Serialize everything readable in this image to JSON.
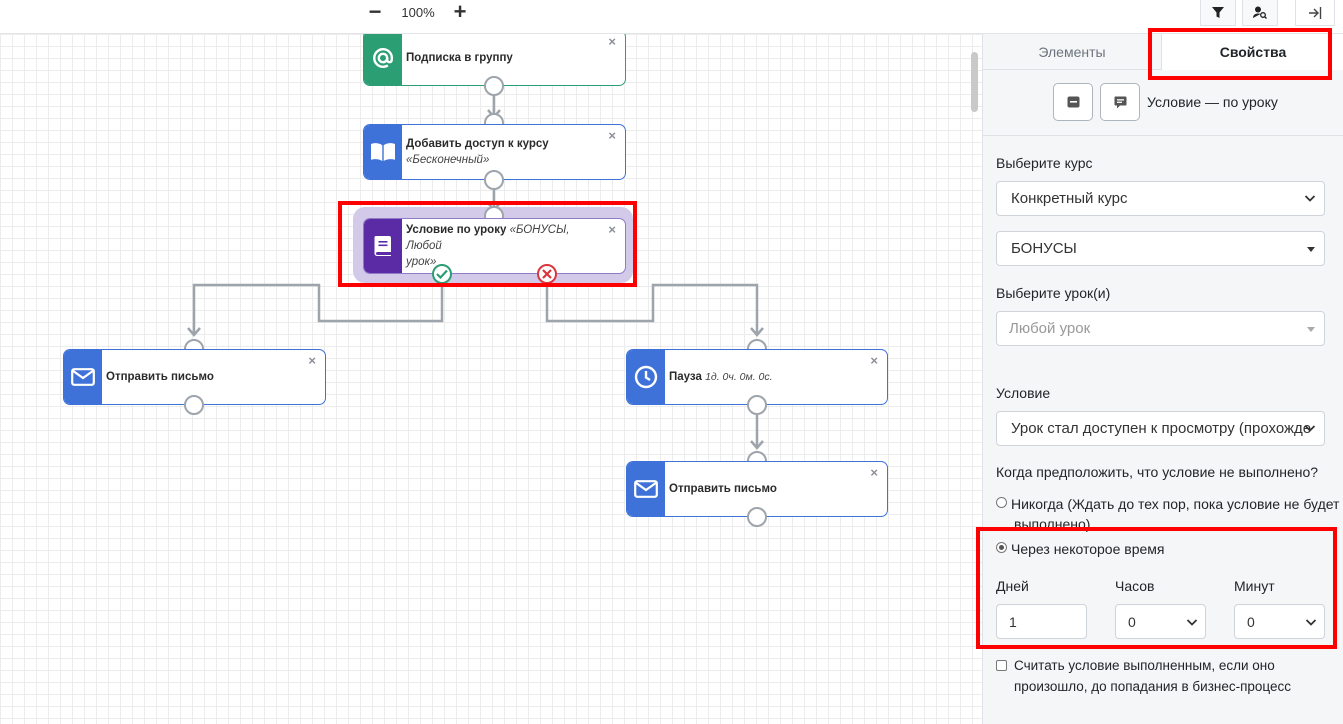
{
  "toolbar": {
    "zoom_out": "−",
    "zoom_level": "100%",
    "zoom_in": "+",
    "icons": [
      "filter-icon",
      "user-search-icon",
      "collapse-panel-icon"
    ]
  },
  "nodes": {
    "subscribe": {
      "title": "Подписка в группу",
      "icon": "at-icon",
      "color": "#2c9e73"
    },
    "add_access": {
      "title": "Добавить доступ к курсу",
      "subtitle": "«Бесконечный»",
      "icon": "book-open-icon",
      "color": "#3f72d9"
    },
    "condition": {
      "title": "Условие по уроку",
      "subtitle_inline": "«БОНУСЫ, Любой",
      "subtitle": "урок»",
      "icon": "lesson-book-icon",
      "color": "#5b2ba6"
    },
    "send_email_left": {
      "title": "Отправить письмо",
      "icon": "envelope-icon",
      "color": "#3f72d9"
    },
    "pause": {
      "title": "Пауза",
      "subtitle_inline": "1д. 0ч. 0м. 0с.",
      "icon": "clock-icon",
      "color": "#3f72d9"
    },
    "send_email_right": {
      "title": "Отправить письмо",
      "icon": "envelope-icon",
      "color": "#3f72d9"
    },
    "close_glyph": "×",
    "yes_color": "#2c9e73",
    "no_color": "#d9363e"
  },
  "panel": {
    "tabs": [
      "Элементы",
      "Свойства"
    ],
    "active_tab": "Свойства",
    "header": "Условие — по уроку",
    "course_label": "Выберите курс",
    "course_mode": "Конкретный курс",
    "course_value": "БОНУСЫ",
    "lesson_label": "Выберите урок(и)",
    "lesson_placeholder": "Любой урок",
    "condition_label": "Условие",
    "condition_value": "Урок стал доступен к просмотру (прохожде",
    "fail_question": "Когда предположить, что условие не выполнено?",
    "option_never_1": "Никогда (Ждать до тех пор, пока условие не будет",
    "option_never_2": "выполнено)",
    "option_after": "Через некоторое время",
    "days_label": "Дней",
    "days_value": "1",
    "hours_label": "Часов",
    "hours_value": "0",
    "minutes_label": "Минут",
    "minutes_value": "0",
    "checkbox_1": "Считать условие выполненным, если оно",
    "checkbox_2": "произошло, до попадания в бизнес-процесс"
  },
  "accent_red": "#ff0000"
}
